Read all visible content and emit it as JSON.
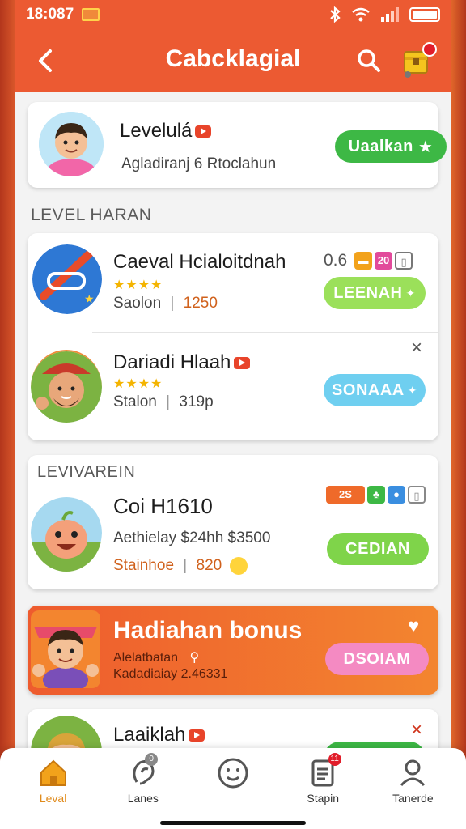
{
  "status_bar": {
    "time": "18:087"
  },
  "header": {
    "title": "Cabcklagial"
  },
  "profile_card": {
    "name": "Levelulá",
    "subtitle": "Agladiranj 6 Rtoclahun",
    "button_label": "Uaalkan",
    "button_icon": "star"
  },
  "section1": {
    "label": "LEVEL HARAN"
  },
  "list": [
    {
      "name": "Caeval Hcialoitdnah",
      "sub_label": "Saolon",
      "sub_value": "1250",
      "corner_text": "0.6",
      "corner_badge": "20",
      "button_label": "LEENAH",
      "button_color": "#9be05a",
      "stars": 4
    },
    {
      "name": "Dariadi Hlaah",
      "sub_label": "Stalon",
      "sub_value": "319p",
      "button_label": "SONAAA",
      "button_color": "#6fcff0",
      "stars": 4
    }
  ],
  "section2": {
    "label": "LEVIVAREIN"
  },
  "featured": {
    "name": "Coi H1610",
    "line1": "Aethielay  $24hh  $3500",
    "line2_label": "Stainhoe",
    "line2_value": "820",
    "badge_text": "2S",
    "button_label": "CEDIAN",
    "button_color": "#7fd44a"
  },
  "bonus": {
    "title": "Hadiahan bonus",
    "line1": "Alelatbatan",
    "line2": "Kadadiaiay 2.46331",
    "button_label": "DSOIAM",
    "bg_color": "#f07c2e",
    "button_color": "#f48ac2"
  },
  "partial_item": {
    "name": "Laaiklah"
  },
  "bottom_nav": [
    {
      "label": "Leval",
      "icon": "home-icon",
      "active": true
    },
    {
      "label": "Lanes",
      "icon": "ear-icon",
      "badge": "0"
    },
    {
      "label": "",
      "icon": "smiley-icon"
    },
    {
      "label": "Stapin",
      "icon": "list-icon",
      "badge": "11"
    },
    {
      "label": "Tanerde",
      "icon": "user-icon"
    }
  ]
}
